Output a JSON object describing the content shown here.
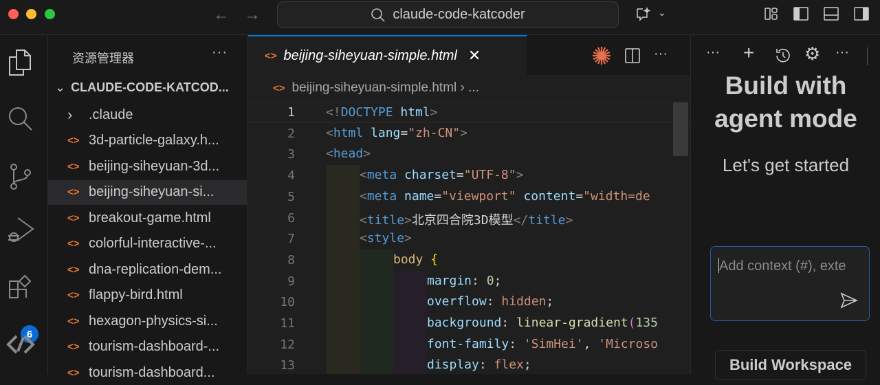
{
  "titlebar": {
    "search_text": "claude-code-katcoder"
  },
  "activity": {
    "extensions_badge": "6"
  },
  "explorer": {
    "title": "资源管理器",
    "more": "···",
    "root": "CLAUDE-CODE-KATCOD...",
    "items": [
      {
        "label": ".claude",
        "type": "folder"
      },
      {
        "label": "3d-particle-galaxy.h...",
        "type": "html"
      },
      {
        "label": "beijing-siheyuan-3d...",
        "type": "html"
      },
      {
        "label": "beijing-siheyuan-si...",
        "type": "html",
        "selected": true
      },
      {
        "label": "breakout-game.html",
        "type": "html"
      },
      {
        "label": "colorful-interactive-...",
        "type": "html"
      },
      {
        "label": "dna-replication-dem...",
        "type": "html"
      },
      {
        "label": "flappy-bird.html",
        "type": "html"
      },
      {
        "label": "hexagon-physics-si...",
        "type": "html"
      },
      {
        "label": "tourism-dashboard-...",
        "type": "html"
      },
      {
        "label": "tourism-dashboard...",
        "type": "html"
      }
    ]
  },
  "editor": {
    "tab_label": "beijing-siheyuan-simple.html",
    "breadcrumb_file": "beijing-siheyuan-simple.html",
    "breadcrumb_rest": "› ...",
    "more": "···",
    "lines": [
      {
        "n": "1",
        "indent": 0,
        "tokens": [
          [
            "<!",
            "tag-p"
          ],
          [
            "DOCTYPE",
            "tag"
          ],
          [
            " html",
            "attr"
          ],
          [
            ">",
            "tag-p"
          ]
        ]
      },
      {
        "n": "2",
        "indent": 0,
        "tokens": [
          [
            "<",
            "tag-p"
          ],
          [
            "html",
            "tag"
          ],
          [
            " lang",
            "attr"
          ],
          [
            "=",
            "punc"
          ],
          [
            "\"zh-CN\"",
            "str"
          ],
          [
            ">",
            "tag-p"
          ]
        ]
      },
      {
        "n": "3",
        "indent": 0,
        "tokens": [
          [
            "<",
            "tag-p"
          ],
          [
            "head",
            "tag"
          ],
          [
            ">",
            "tag-p"
          ]
        ]
      },
      {
        "n": "4",
        "indent": 1,
        "tokens": [
          [
            "<",
            "tag-p"
          ],
          [
            "meta",
            "tag"
          ],
          [
            " charset",
            "attr"
          ],
          [
            "=",
            "punc"
          ],
          [
            "\"UTF-8\"",
            "str"
          ],
          [
            ">",
            "tag-p"
          ]
        ]
      },
      {
        "n": "5",
        "indent": 1,
        "tokens": [
          [
            "<",
            "tag-p"
          ],
          [
            "meta",
            "tag"
          ],
          [
            " name",
            "attr"
          ],
          [
            "=",
            "punc"
          ],
          [
            "\"viewport\"",
            "str"
          ],
          [
            " content",
            "attr"
          ],
          [
            "=",
            "punc"
          ],
          [
            "\"width=de",
            "str"
          ]
        ]
      },
      {
        "n": "6",
        "indent": 1,
        "tokens": [
          [
            "<",
            "tag-p"
          ],
          [
            "title",
            "tag"
          ],
          [
            ">",
            "tag-p"
          ],
          [
            "北京四合院3D模型",
            "txtc"
          ],
          [
            "</",
            "tag-p"
          ],
          [
            "title",
            "tag"
          ],
          [
            ">",
            "tag-p"
          ]
        ]
      },
      {
        "n": "7",
        "indent": 1,
        "tokens": [
          [
            "<",
            "tag-p"
          ],
          [
            "style",
            "tag"
          ],
          [
            ">",
            "tag-p"
          ]
        ]
      },
      {
        "n": "8",
        "indent": 2,
        "tokens": [
          [
            "body",
            "sel-c"
          ],
          [
            " {",
            "brace"
          ]
        ]
      },
      {
        "n": "9",
        "indent": 3,
        "tokens": [
          [
            "margin",
            "prop"
          ],
          [
            ": ",
            "punc"
          ],
          [
            "0",
            "num"
          ],
          [
            ";",
            "punc"
          ]
        ]
      },
      {
        "n": "10",
        "indent": 3,
        "tokens": [
          [
            "overflow",
            "prop"
          ],
          [
            ": ",
            "punc"
          ],
          [
            "hidden",
            "val"
          ],
          [
            ";",
            "punc"
          ]
        ]
      },
      {
        "n": "11",
        "indent": 3,
        "tokens": [
          [
            "background",
            "prop"
          ],
          [
            ": ",
            "punc"
          ],
          [
            "linear-gradient",
            "fn"
          ],
          [
            "(",
            "paren"
          ],
          [
            "135",
            "num"
          ]
        ]
      },
      {
        "n": "12",
        "indent": 3,
        "tokens": [
          [
            "font-family",
            "prop"
          ],
          [
            ": ",
            "punc"
          ],
          [
            "'SimHei'",
            "val"
          ],
          [
            ", ",
            "punc"
          ],
          [
            "'Microso",
            "val"
          ]
        ]
      },
      {
        "n": "13",
        "indent": 3,
        "tokens": [
          [
            "display",
            "prop"
          ],
          [
            ": ",
            "punc"
          ],
          [
            "flex",
            "val"
          ],
          [
            ";",
            "punc"
          ]
        ]
      }
    ]
  },
  "chat": {
    "heading_line1": "Build with",
    "heading_line2": "agent mode",
    "subheading": "Let's get started",
    "input_placeholder": "Add context (#), exte",
    "build_workspace": "Build Workspace",
    "more": "···"
  },
  "colors": {
    "accent": "#0078d4",
    "html_icon": "#e37933",
    "badge": "#0a6bd8"
  }
}
